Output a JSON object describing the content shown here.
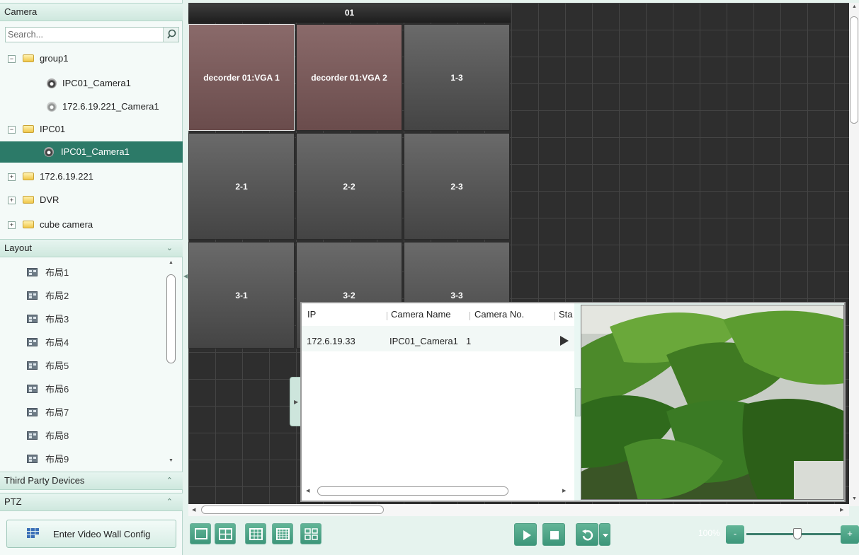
{
  "camera_panel": {
    "title": "Camera",
    "search_placeholder": "Search...",
    "tree": [
      {
        "label": "group1",
        "kind": "folder",
        "expander": "−"
      },
      {
        "label": "IPC01_Camera1",
        "kind": "camera"
      },
      {
        "label": "172.6.19.221_Camera1",
        "kind": "camera-offline"
      },
      {
        "label": "IPC01",
        "kind": "folder",
        "expander": "−"
      },
      {
        "label": "IPC01_Camera1",
        "kind": "camera",
        "selected": true
      },
      {
        "label": "172.6.19.221",
        "kind": "folder",
        "expander": "+"
      },
      {
        "label": "DVR",
        "kind": "folder",
        "expander": "+"
      },
      {
        "label": "cube camera",
        "kind": "folder",
        "expander": "+"
      }
    ]
  },
  "layout_panel": {
    "title": "Layout",
    "items": [
      "布局1",
      "布局2",
      "布局3",
      "布局4",
      "布局5",
      "布局6",
      "布局7",
      "布局8",
      "布局9"
    ]
  },
  "third_party": {
    "title": "Third Party Devices"
  },
  "ptz": {
    "title": "PTZ"
  },
  "video_wall_button": {
    "label": "Enter Video Wall Config"
  },
  "wall": {
    "title": "01",
    "cells": [
      "decorder 01:VGA 1",
      "decorder 01:VGA 2",
      "1-3",
      "2-1",
      "2-2",
      "2-3",
      "3-1",
      "3-2",
      "3-3"
    ]
  },
  "popup": {
    "columns": [
      "IP",
      "Camera Name",
      "Camera No.",
      "Sta"
    ],
    "row": {
      "ip": "172.6.19.33",
      "camera_name": "IPC01_Camera1",
      "camera_no": "1",
      "status_icon": "play-icon"
    }
  },
  "toolbar": {
    "zoom_label": "100%",
    "zoom_minus": "-",
    "zoom_plus": "+",
    "zoom_level": 0.5
  },
  "colors": {
    "accent": "#2c7a68",
    "button": "#4da488",
    "wall_bg": "#2e2e2e"
  }
}
